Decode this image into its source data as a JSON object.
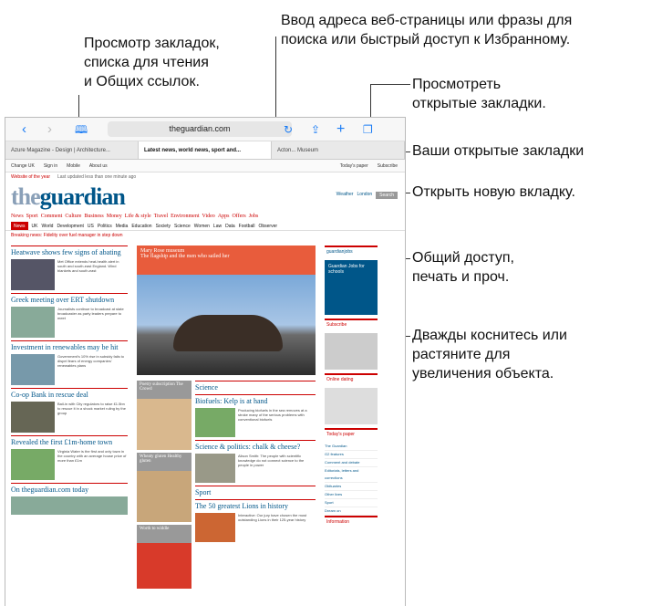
{
  "callouts": {
    "top_right": [
      "Ввод адреса веб-страницы или фразы для",
      "поиска или быстрый доступ к Избранному."
    ],
    "bookmarks": [
      "Просмотр закладок,",
      "списка для чтения",
      "и Общих ссылок."
    ],
    "view_tabs": [
      "Просмотреть",
      "открытые закладки."
    ],
    "open_tabs": "Ваши открытые закладки",
    "new_tab": "Открыть новую вкладку.",
    "share": [
      "Общий доступ,",
      "печать и проч."
    ],
    "zoom": [
      "Дважды коснитесь или",
      "растяните для",
      "увеличения объекта."
    ]
  },
  "toolbar": {
    "back_icon": "chevron-left-icon",
    "forward_icon": "chevron-right-icon",
    "bookmarks_icon": "book-icon",
    "address": "theguardian.com",
    "reload_icon": "reload-icon",
    "share_icon": "share-icon",
    "new_tab_icon": "plus-icon",
    "tabs_icon": "tabs-icon"
  },
  "tabs": [
    {
      "label": "Azure Magazine - Design | Architecture...",
      "active": false
    },
    {
      "label": "Latest news, world news, sport and...",
      "active": true
    },
    {
      "label": "Acton... Museum",
      "active": false
    }
  ],
  "site": {
    "subbar_left": [
      "Change UK",
      "Sign in",
      "Mobile",
      "About us"
    ],
    "subbar_right": [
      "Today's paper",
      "Subscribe"
    ],
    "strip": [
      "Website of the year",
      "Last updated less than one minute ago"
    ],
    "logo_the": "the",
    "logo_guardian": "guardian",
    "mh_right": [
      "Weather",
      "London",
      "Search"
    ],
    "sections": [
      "News",
      "Sport",
      "Comment",
      "Culture",
      "Business",
      "Money",
      "Life & style",
      "Travel",
      "Environment",
      "Video",
      "Apps",
      "Offers",
      "Jobs"
    ],
    "subnav": [
      "News",
      "UK",
      "World",
      "Development",
      "US",
      "Politics",
      "Media",
      "Education",
      "Society",
      "Science",
      "Women",
      "Law",
      "Data",
      "Football",
      "Observer"
    ],
    "breaking": "Breaking news: Fidelity over fuel manager in step down",
    "left_col": [
      {
        "h": "Heatwave shows few signs of abating",
        "t": "Met Office extends heat-health alert in south and south-east England. Wind blankets and south-east"
      },
      {
        "h": "Greek meeting over ERT shutdown",
        "t": "Journalists continue to broadcast at state broadcaster as party leaders prepare to meet"
      },
      {
        "h": "Investment in renewables may be hit",
        "t": "Government's 10% rise in subsidy fails to dispel fears of energy companies' renewables plans"
      },
      {
        "h": "Co-op Bank in rescue deal",
        "t": "Bail-in with City regulators to raise £1.5bn to rescue it in a shock market ruling by the group"
      },
      {
        "h": "Revealed the first £1m-home town",
        "t": "Virginia Water is the first and only town in the country with an average house price of more than £1m"
      },
      {
        "h": "On theguardian.com today",
        "t": ""
      }
    ],
    "center_feature": [
      "Mary Rose museum",
      "The flagship and the men who sailed her"
    ],
    "center_grey": [
      "Poetry subscription The Crowd",
      "Wheaty gluten Healthy gluten",
      "Worth to widdle"
    ],
    "center_heads": [
      {
        "h": "Science",
        "t": ""
      },
      {
        "h": "Biofuels: Kelp is at hand",
        "t": "Producing biofuels in the sea removes at a stroke many of the serious problems with conventional biofuels"
      },
      {
        "h": "Science & politics: chalk & cheese?",
        "t": "Alison Smith: The people with scientific knowledge do not connect science to the people in power"
      },
      {
        "h": "Sport",
        "t": ""
      },
      {
        "h": "The 50 greatest Lions in history",
        "t": "Interactive: Our jury have chosen the most outstanding Lions in their 125-year history"
      }
    ],
    "right_col": {
      "jobs_title": "guardianjobs",
      "jobs_ad": "Guardian Jobs for schools",
      "boxes": [
        "Subscribe",
        "Online dating",
        "Today's paper",
        "Information"
      ],
      "links": [
        "The Guardian",
        "G2 features",
        "Comment and debate",
        "Editorials, letters and corrections",
        "Obituaries",
        "Other lives",
        "Sport",
        "Dream on"
      ]
    }
  }
}
